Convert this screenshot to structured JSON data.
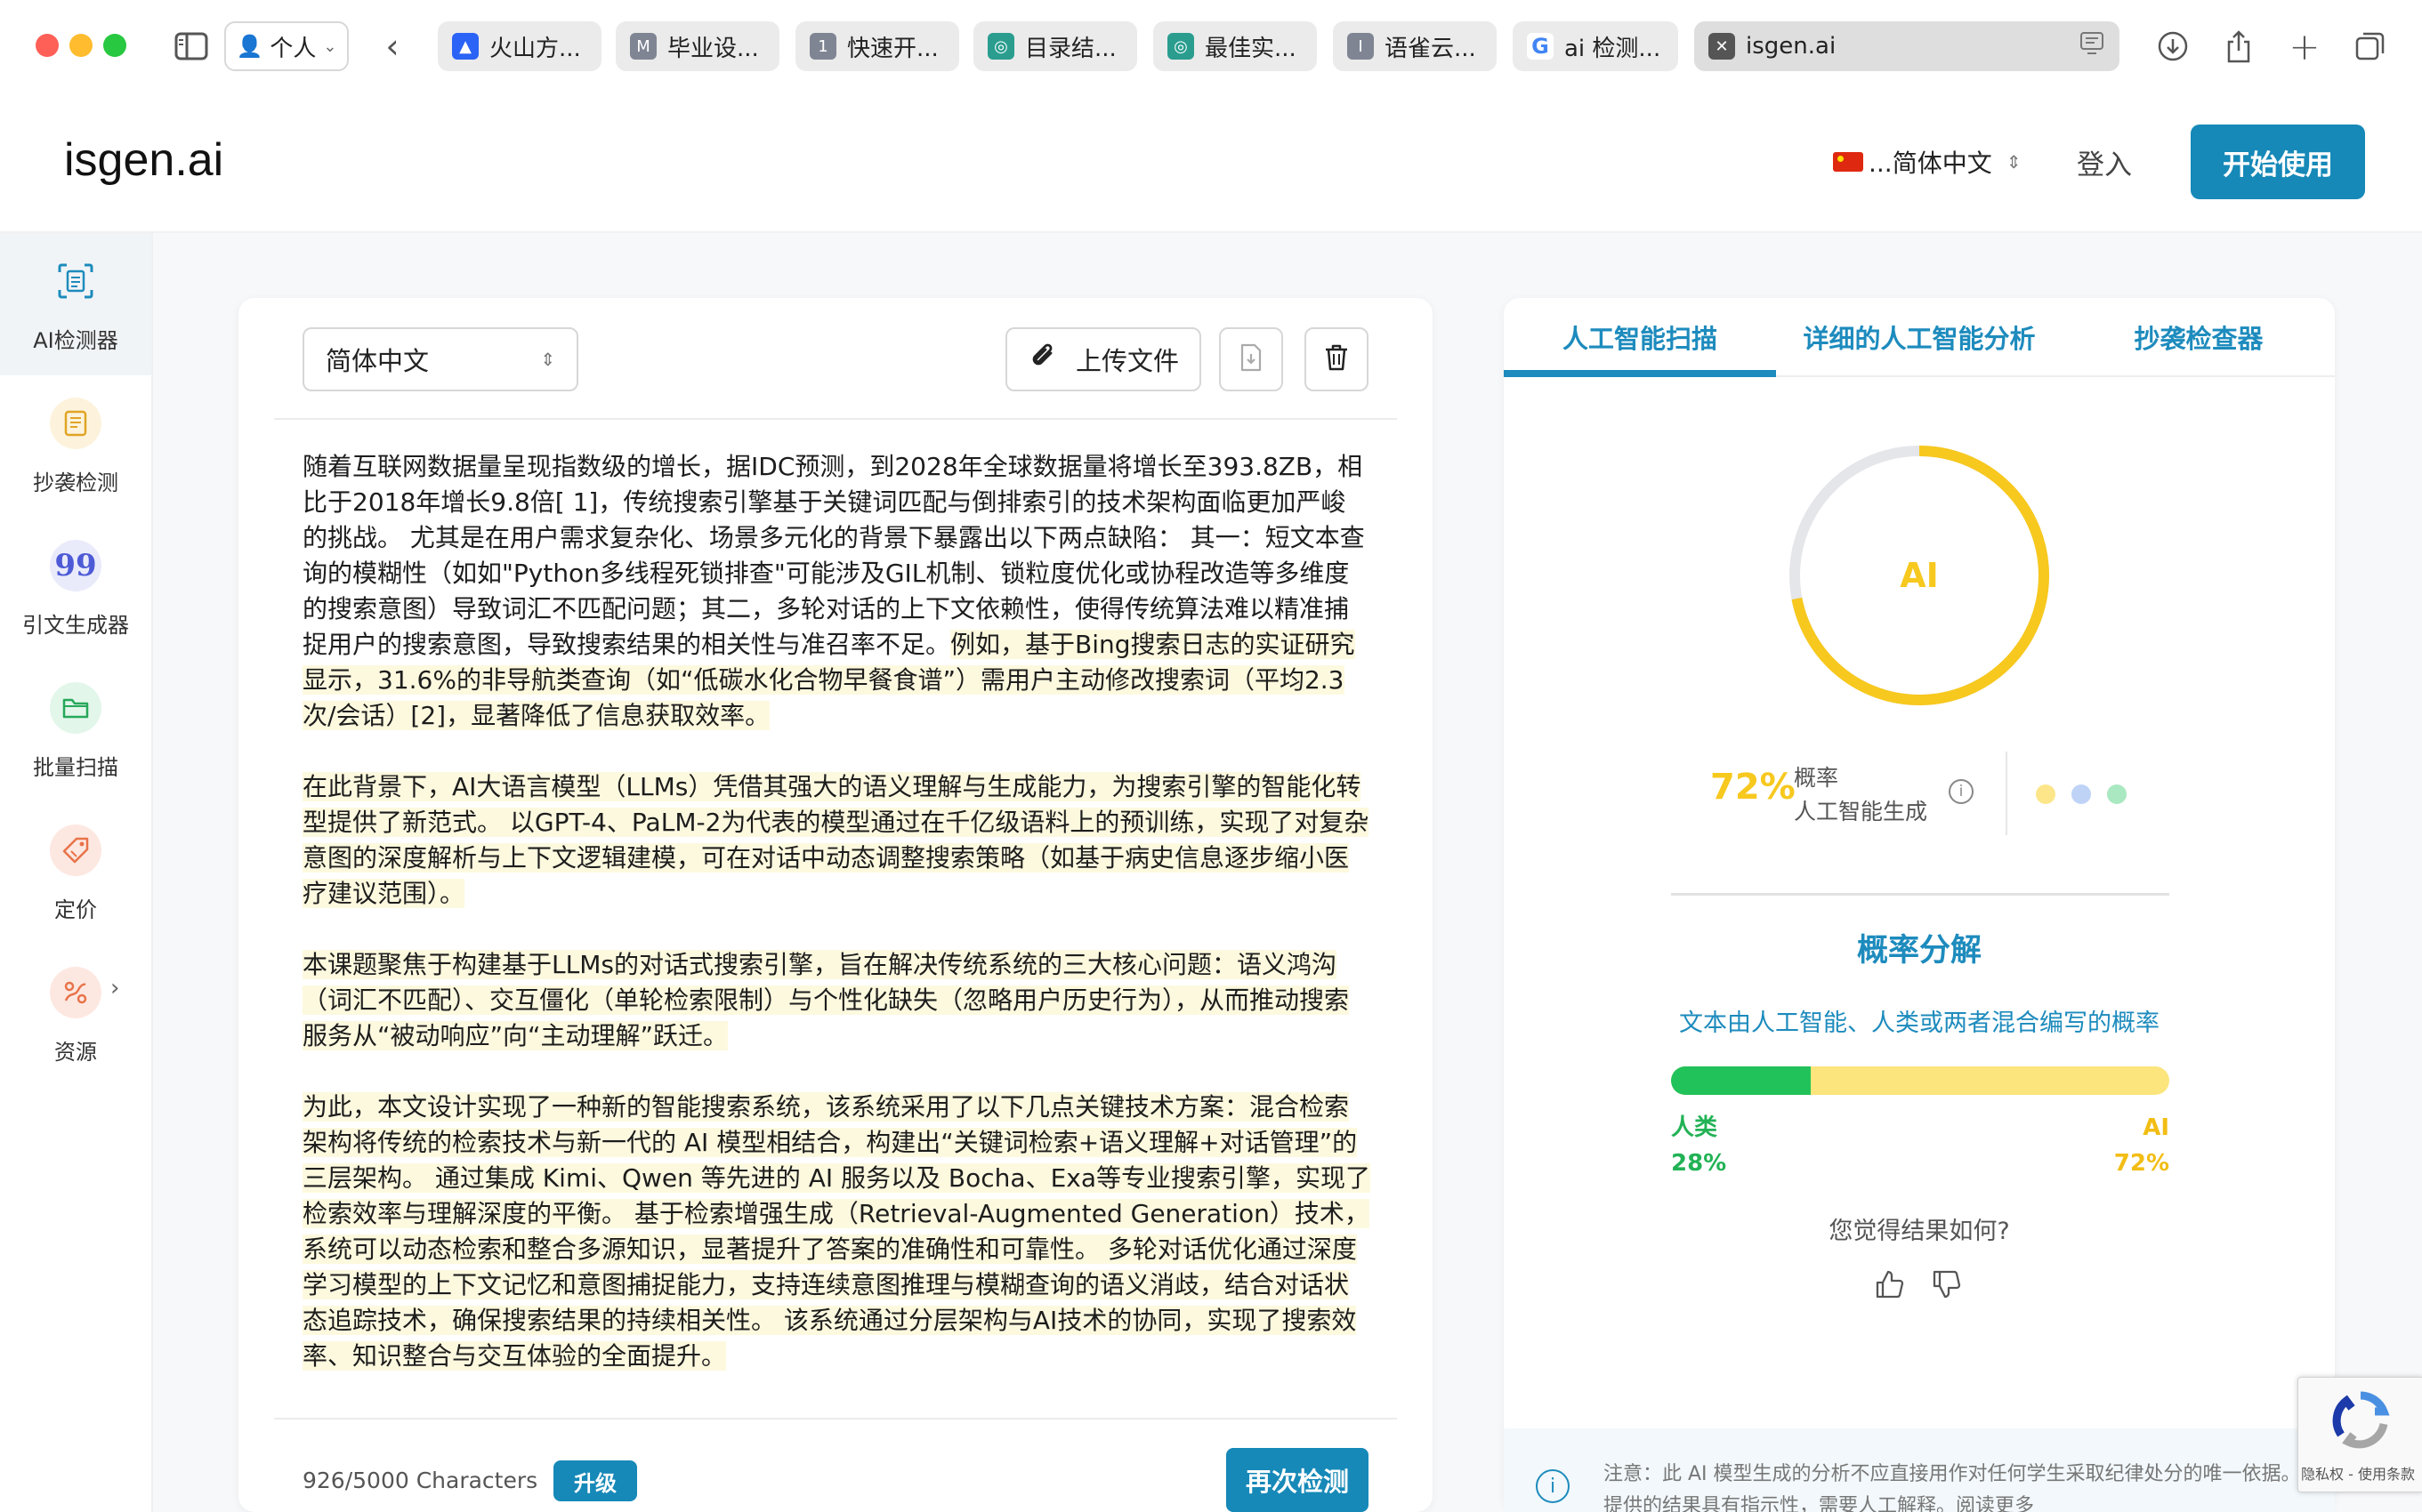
{
  "browser": {
    "profile": "个人",
    "tabs": [
      {
        "label": "火山方...",
        "fav_color": "#2a63f5",
        "fav_glyph": "▲"
      },
      {
        "label": "毕业设...",
        "fav_color": "#7f8593",
        "fav_glyph": "M"
      },
      {
        "label": "快速开...",
        "fav_color": "#7f8593",
        "fav_glyph": "1"
      },
      {
        "label": "目录结...",
        "fav_color": "#2a9d8f",
        "fav_glyph": "◎"
      },
      {
        "label": "最佳实...",
        "fav_color": "#2a9d8f",
        "fav_glyph": "◎"
      },
      {
        "label": "语雀云...",
        "fav_color": "#7f8593",
        "fav_glyph": "I"
      },
      {
        "label": "ai 检测...",
        "fav_color": "#ffffff",
        "fav_glyph": "G"
      },
      {
        "label": "isgen.ai",
        "fav_color": "#555555",
        "fav_glyph": "✕"
      }
    ]
  },
  "header": {
    "logo": "isgen.ai",
    "language": "...简体中文",
    "login": "登入",
    "start": "开始使用"
  },
  "sidebar": {
    "items": [
      {
        "label": "AI检测器",
        "icon": "ai-scan-icon"
      },
      {
        "label": "抄袭检测",
        "icon": "plagiarism-icon"
      },
      {
        "label": "引文生成器",
        "icon": "quote-icon"
      },
      {
        "label": "批量扫描",
        "icon": "folder-icon"
      },
      {
        "label": "定价",
        "icon": "tag-icon"
      },
      {
        "label": "资源",
        "icon": "resources-icon"
      }
    ]
  },
  "editor": {
    "language": "简体中文",
    "upload": "上传文件",
    "paragraphs": [
      {
        "plain": "随着互联网数据量呈现指数级的增长，据IDC预测，到2028年全球数据量将增长至393.8ZB，相比于2018年增长9.8倍[ 1]，传统搜索引擎基于关键词匹配与倒排索引的技术架构面临更加严峻的挑战。 尤其是在用户需求复杂化、场景多元化的背景下暴露出以下两点缺陷： 其一：短文本查询的模糊性（如如\"Python多线程死锁排查\"可能涉及GIL机制、锁粒度优化或协程改造等多维度的搜索意图）导致词汇不匹配问题；其二，多轮对话的上下文依赖性，使得传统算法难以精准捕捉用户的搜索意图，导致搜索结果的相关性与准召率不足。",
        "highlight": "例如，基于Bing搜索日志的实证研究显示，31.6%的非导航类查询（如“低碳水化合物早餐食谱”）需用户主动修改搜索词（平均2.3次/会话）[2]，显著降低了信息获取效率。"
      },
      {
        "plain": "",
        "highlight": "在此背景下，AI大语言模型（LLMs）凭借其强大的语义理解与生成能力，为搜索引擎的智能化转型提供了新范式。 以GPT-4、PaLM-2为代表的模型通过在千亿级语料上的预训练，实现了对复杂意图的深度解析与上下文逻辑建模，可在对话中动态调整搜索策略（如基于病史信息逐步缩小医疗建议范围）。"
      },
      {
        "plain": "",
        "highlight": "本课题聚焦于构建基于LLMs的对话式搜索引擎，旨在解决传统系统的三大核心问题：语义鸿沟（词汇不匹配）、交互僵化（单轮检索限制）与个性化缺失（忽略用户历史行为），从而推动搜索服务从“被动响应”向“主动理解”跃迁。"
      },
      {
        "plain": "",
        "highlight": "为此，本文设计实现了一种新的智能搜索系统，该系统采用了以下几点关键技术方案：混合检索架构将传统的检索技术与新一代的 AI 模型相结合，构建出“关键词检索+语义理解+对话管理”的三层架构。 通过集成 Kimi、Qwen 等先进的 AI 服务以及 Bocha、Exa等专业搜索引擎，实现了检索效率与理解深度的平衡。 基于检索增强生成（Retrieval-Augmented Generation）技术，系统可以动态检索和整合多源知识，显著提升了答案的准确性和可靠性。 多轮对话优化通过深度学习模型的上下文记忆和意图捕捉能力，支持连续意图推理与模糊查询的语义消歧，结合对话状态追踪技术，确保搜索结果的持续相关性。 该系统通过分层架构与AI技术的协同，实现了搜索效率、知识整合与交互体验的全面提升。"
      }
    ],
    "char_count": "926/5000 Characters",
    "upgrade": "升级",
    "recheck": "再次检测"
  },
  "results": {
    "tabs": [
      "人工智能扫描",
      "详细的人工智能分析",
      "抄袭检查器"
    ],
    "donut_label": "AI",
    "ai_fraction": 0.72,
    "ai_percent": "72%",
    "prob_line1": "概率",
    "prob_line2": "人工智能生成",
    "colors": {
      "ai": "#f7c81e",
      "track": "#e5e6ea",
      "human": "#22c25a",
      "mixed": "#8ab4f8",
      "accent": "#1d8bbd"
    },
    "breakdown_title": "概率分解",
    "breakdown_sub": "文本由人工智能、人类或两者混合编写的概率",
    "human_label": "人类",
    "human_percent": "28%",
    "human_fraction": 0.28,
    "ai_label": "AI",
    "feedback_q": "您觉得结果如何?",
    "notice": "注意：此 AI 模型生成的分析不应直接用作对任何学生采取纪律处分的唯一依据。",
    "notice2": "提供的结果具有指示性，需要人工解释。",
    "read_more": "阅读更多"
  },
  "recaptcha": {
    "text": "隐私权 - 使用条款"
  }
}
